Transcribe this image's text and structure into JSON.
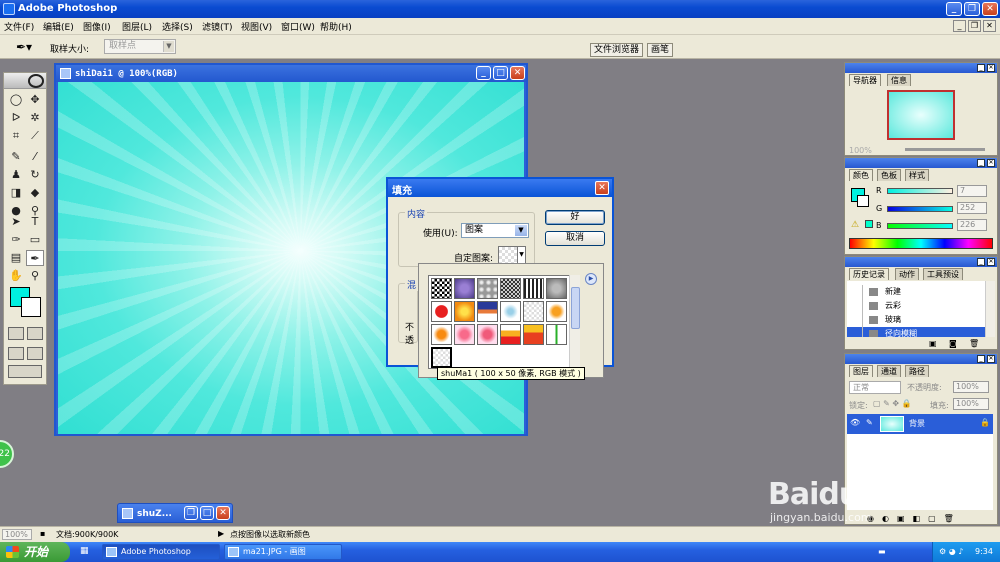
{
  "app": {
    "title": "Adobe Photoshop"
  },
  "menu": [
    "文件(F)",
    "编辑(E)",
    "图像(I)",
    "图层(L)",
    "选择(S)",
    "滤镜(T)",
    "视图(V)",
    "窗口(W)",
    "帮助(H)"
  ],
  "options": {
    "sample_size_label": "取样大小:",
    "sample_size_value": "取样点",
    "file_browser_tab": "文件浏览器",
    "brushes_tab": "画笔"
  },
  "colors": {
    "foreground": "#00f0e0",
    "background": "#ffffff"
  },
  "document": {
    "title": "shiDai1 @ 100%(RGB)"
  },
  "fill_dialog": {
    "title": "填充",
    "content_legend": "内容",
    "use_label": "使用(U):",
    "use_value": "图案",
    "custom_pattern_label": "自定图案:",
    "ok_label": "好",
    "cancel_label": "取消",
    "blend_legend_partial": "混",
    "opacity_label_partial": "不透"
  },
  "pattern_tooltip": "shuMa1 ( 100 x 50 像素, RGB 模式 )",
  "navigator": {
    "tabs": [
      "导航器",
      "信息"
    ],
    "zoom_value": "100%"
  },
  "color_panel": {
    "tabs": [
      "颜色",
      "色板",
      "样式"
    ],
    "channels": [
      {
        "label": "R",
        "value": "7"
      },
      {
        "label": "G",
        "value": "252"
      },
      {
        "label": "B",
        "value": "226"
      }
    ]
  },
  "history": {
    "tabs": [
      "历史记录",
      "动作",
      "工具预设"
    ],
    "items": [
      "新建",
      "云彩",
      "玻璃",
      "径向模糊"
    ]
  },
  "layers": {
    "tabs": [
      "图层",
      "通道",
      "路径"
    ],
    "blend_mode": "正常",
    "opacity_label": "不透明度:",
    "opacity_value": "100%",
    "lock_label": "锁定:",
    "fill_label": "填充:",
    "fill_value": "100%",
    "layer_name": "背景"
  },
  "status": {
    "zoom": "100%",
    "doc_info": "文档:900K/900K",
    "hint": "点按图像以选取新颜色"
  },
  "minimized_window": {
    "title": "shuZ..."
  },
  "taskbar": {
    "start": "开始",
    "tasks": [
      "Adobe Photoshop",
      "ma21.JPG - 画图"
    ],
    "clock": "9:34"
  },
  "side_badge": "22",
  "watermark": {
    "text": "Baidu经验",
    "url": "jingyan.baidu.com"
  }
}
